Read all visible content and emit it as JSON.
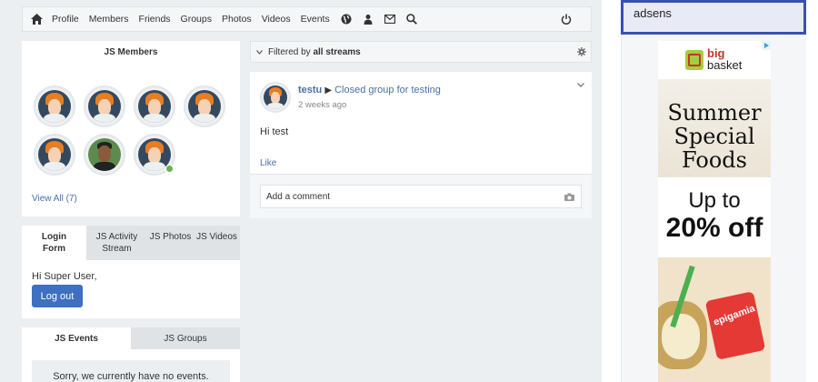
{
  "navbar": {
    "items": [
      "Profile",
      "Members",
      "Friends",
      "Groups",
      "Photos",
      "Videos",
      "Events"
    ],
    "icons": [
      "home-icon",
      "globe-icon",
      "user-add-icon",
      "mail-icon",
      "search-icon",
      "power-icon"
    ]
  },
  "members_widget": {
    "title": "JS Members",
    "view_all": "View All (7)"
  },
  "login_widget": {
    "tabs": [
      "Login Form",
      "JS Activity Stream",
      "JS Photos",
      "JS Videos"
    ],
    "greeting": "Hi Super User,",
    "logout": "Log out"
  },
  "events_widget": {
    "tabs": [
      "JS Events",
      "JS Groups"
    ],
    "empty": "Sorry, we currently have no events."
  },
  "stream": {
    "filter_prefix": "Filtered by ",
    "filter_value": "all streams",
    "post": {
      "author": "testu",
      "arrow": "▶",
      "group": "Closed group for testing",
      "time": "2 weeks ago",
      "body": "Hi test",
      "like": "Like",
      "comment_placeholder": "Add a comment"
    }
  },
  "sidebar": {
    "adsens_label": "adsens",
    "ad": {
      "brand_top": "big",
      "brand_bottom": "basket",
      "headline": [
        "Summer",
        "Special",
        "Foods"
      ],
      "offer_line1": "Up to",
      "offer_line2": "20% off",
      "product": "epigamia"
    }
  },
  "colors": {
    "accent": "#3f6fc0",
    "link": "#4a6fa5",
    "online": "#6ab04c",
    "adsens_border": "#3a4fb5"
  }
}
